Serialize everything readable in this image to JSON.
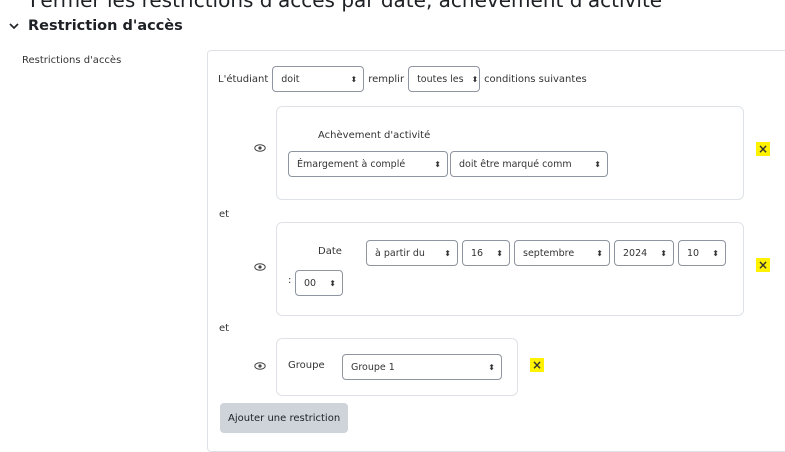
{
  "clipped_title": "Fermer les restrictions d'accès par date, achèvement d'activité",
  "section": {
    "title": "Restriction d'accès"
  },
  "field_label": "Restrictions d'accès",
  "intro": {
    "student_label": "L'étudiant",
    "must_select": "doit",
    "fulfill_label": "remplir",
    "all_select": "toutes les",
    "conditions_label": "conditions suivantes"
  },
  "conditions": [
    {
      "title": "Achèvement d'activité",
      "activity_select": "Émargement à complé",
      "state_select": "doit être marqué comm"
    },
    {
      "title": "Date",
      "direction_select": "à partir du",
      "day_select": "16",
      "month_select": "septembre",
      "year_select": "2024",
      "hour_select": "10",
      "minute_sep": ":",
      "minute_select": "00"
    },
    {
      "title": "Groupe",
      "group_select": "Groupe 1"
    }
  ],
  "connector": "et",
  "delete_glyph": "×",
  "caret_glyph": "⬍",
  "add_button": "Ajouter une restriction",
  "colors": {
    "highlight": "#fff200",
    "border": "#dee2e6",
    "button_bg": "#ced4da"
  }
}
